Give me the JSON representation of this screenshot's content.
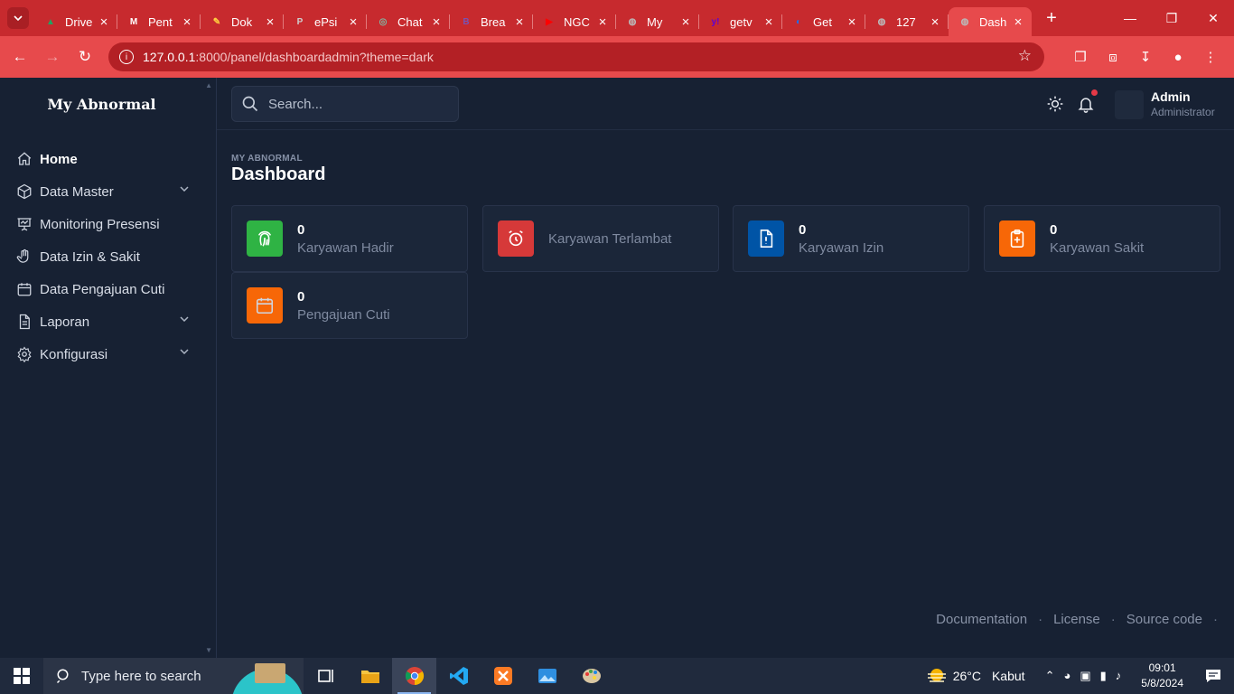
{
  "browser": {
    "tabs": [
      {
        "title": "Drive",
        "color": "#1fa463",
        "glyph": "▲"
      },
      {
        "title": "Pent",
        "color": "#ffffff",
        "glyph": "M"
      },
      {
        "title": "Dok",
        "color": "#ffcf3f",
        "glyph": "✎"
      },
      {
        "title": "ePsi",
        "color": "#cfcfcf",
        "glyph": "P"
      },
      {
        "title": "Chat",
        "color": "#7fb8a4",
        "glyph": "◎"
      },
      {
        "title": "Brea",
        "color": "#7952b3",
        "glyph": "B"
      },
      {
        "title": "NGC",
        "color": "#ff0000",
        "glyph": "▶"
      },
      {
        "title": "My",
        "color": "#bbbbbb",
        "glyph": "◍"
      },
      {
        "title": "getv",
        "color": "#6001d2",
        "glyph": "y!"
      },
      {
        "title": "Get",
        "color": "#1a6ef5",
        "glyph": "◐"
      },
      {
        "title": "127",
        "color": "#bbbbbb",
        "glyph": "◍"
      },
      {
        "title": "Dash",
        "color": "#bbbbbb",
        "glyph": "◍"
      }
    ],
    "url_host": "127.0.0.1",
    "url_path": ":8000/panel/dashboardadmin?theme=dark"
  },
  "brand": "My Abnormal",
  "sidebar": {
    "items": [
      {
        "label": "Home",
        "icon": "home-icon",
        "active": true,
        "chevron": false
      },
      {
        "label": "Data Master",
        "icon": "box-icon",
        "active": false,
        "chevron": true
      },
      {
        "label": "Monitoring Presensi",
        "icon": "presentation-icon",
        "active": false,
        "chevron": false
      },
      {
        "label": "Data Izin & Sakit",
        "icon": "hand-icon",
        "active": false,
        "chevron": false
      },
      {
        "label": "Data Pengajuan Cuti",
        "icon": "calendar-icon",
        "active": false,
        "chevron": false
      },
      {
        "label": "Laporan",
        "icon": "file-icon",
        "active": false,
        "chevron": true
      },
      {
        "label": "Konfigurasi",
        "icon": "settings-icon",
        "active": false,
        "chevron": true
      }
    ]
  },
  "header": {
    "search_placeholder": "Search...",
    "user_name": "Admin",
    "user_role": "Administrator"
  },
  "page": {
    "pretitle": "MY ABNORMAL",
    "title": "Dashboard"
  },
  "cards": [
    {
      "value": "0",
      "label": "Karyawan Hadir",
      "color": "#2fb344",
      "icon": "fingerprint-icon"
    },
    {
      "value": "",
      "label": "Karyawan Terlambat",
      "color": "#d63939",
      "icon": "alarm-icon"
    },
    {
      "value": "0",
      "label": "Karyawan Izin",
      "color": "#0054a6",
      "icon": "file-alert-icon"
    },
    {
      "value": "0",
      "label": "Karyawan Sakit",
      "color": "#f76707",
      "icon": "clipboard-plus-icon"
    },
    {
      "value": "0",
      "label": "Pengajuan Cuti",
      "color": "#f76707",
      "icon": "calendar-icon"
    }
  ],
  "footer": {
    "links": [
      "Documentation",
      "License",
      "Source code"
    ]
  },
  "taskbar": {
    "search_text": "Type here to search",
    "weather_temp": "26°C",
    "weather_desc": "Kabut",
    "time": "09:01",
    "date": "5/8/2024"
  }
}
